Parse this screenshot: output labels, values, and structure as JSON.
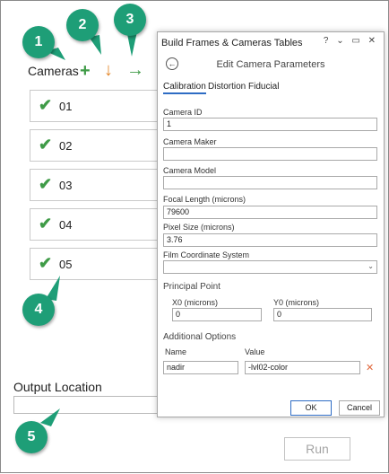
{
  "cameras_pane": {
    "title": "Cameras",
    "add_symbol": "+",
    "import_symbol": "↓",
    "forward_symbol": "→",
    "colors": {
      "add": "#3f9b47",
      "import": "#e4872a",
      "forward": "#3f9b47"
    },
    "rows": [
      {
        "check": "✔",
        "label": "01"
      },
      {
        "check": "✔",
        "label": "02"
      },
      {
        "check": "✔",
        "label": "03"
      },
      {
        "check": "✔",
        "label": "04"
      },
      {
        "check": "✔",
        "label": "05"
      }
    ],
    "output_label": "Output Location",
    "output_value": "",
    "run_label": "Run"
  },
  "callouts": [
    "1",
    "2",
    "3",
    "4",
    "5"
  ],
  "dialog": {
    "title": "Build Frames & Cameras Tables",
    "controls": "? ⌄ ▭ ✕",
    "back_icon": "back-icon",
    "heading": "Edit Camera Parameters",
    "tabs": [
      "Calibration",
      "Distortion",
      "Fiducial"
    ],
    "active_tab": "Calibration",
    "fields": {
      "camera_id": {
        "label": "Camera ID",
        "value": "1"
      },
      "camera_maker": {
        "label": "Camera Maker",
        "value": ""
      },
      "camera_model": {
        "label": "Camera Model",
        "value": ""
      },
      "focal_length": {
        "label": "Focal Length (microns)",
        "value": "79600"
      },
      "pixel_size": {
        "label": "Pixel Size (microns)",
        "value": "3.76"
      },
      "film_cs": {
        "label": "Film Coordinate System",
        "value": ""
      }
    },
    "principal_point": {
      "title": "Principal Point",
      "x0_label": "X0 (microns)",
      "x0_value": "0",
      "y0_label": "Y0 (microns)",
      "y0_value": "0"
    },
    "additional_options": {
      "title": "Additional Options",
      "name_header": "Name",
      "value_header": "Value",
      "row_name": "nadir",
      "row_value": "-lvl02-color",
      "remove_symbol": "✕"
    },
    "ok_label": "OK",
    "cancel_label": "Cancel"
  }
}
